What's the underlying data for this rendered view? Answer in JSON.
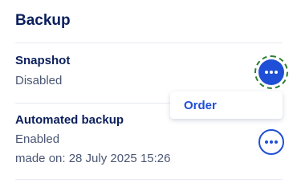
{
  "section": {
    "title": "Backup"
  },
  "snapshot": {
    "title": "Snapshot",
    "status": "Disabled",
    "menu_icon": "more-horizontal-icon"
  },
  "menu": {
    "items": [
      {
        "label": "Order"
      }
    ]
  },
  "automated_backup": {
    "title": "Automated backup",
    "status": "Enabled",
    "made_on": "made on: 28 July 2025 15:26",
    "menu_icon": "more-horizontal-icon"
  },
  "colors": {
    "heading": "#0b1f5c",
    "accent": "#1f4fd6",
    "text_muted": "#4a5674",
    "focus_ring": "#2e7d32"
  }
}
